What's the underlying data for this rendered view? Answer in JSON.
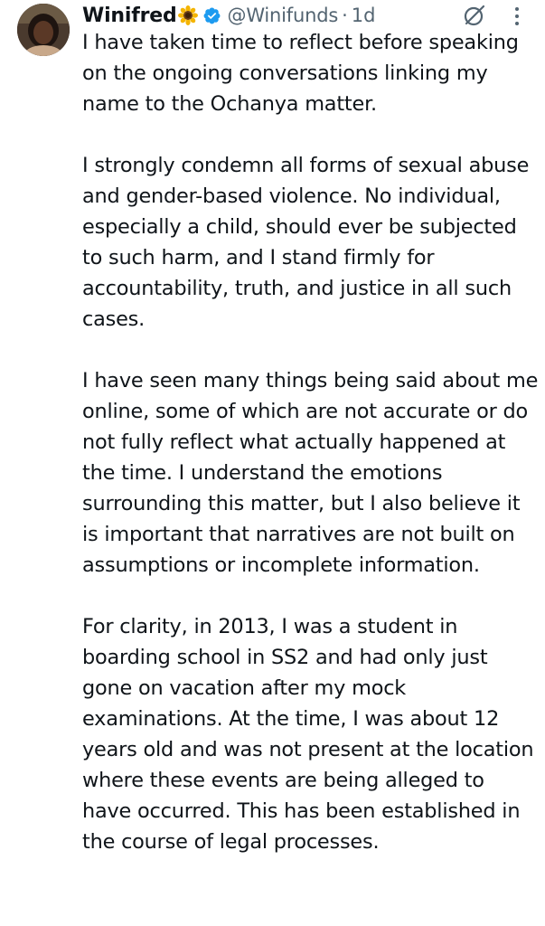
{
  "tweet": {
    "author": {
      "name": "Winifred",
      "handle": "@Winifunds",
      "separator": "·",
      "time": "1d",
      "verified": true,
      "name_emoji": "sunflower"
    },
    "icons": {
      "more": "more-vertical-icon",
      "grok": "grok-icon",
      "verified": "verified-badge-icon"
    },
    "colors": {
      "text": "#0f1419",
      "secondary": "#536471",
      "verified_blue": "#1d9bf0"
    },
    "paragraphs": [
      "I have taken time to reflect before speaking on the ongoing conversations linking my name to the Ochanya matter.",
      "I strongly condemn all forms of sexual abuse and gender-based violence. No individual, especially a child, should ever be subjected to such harm, and I stand firmly for accountability, truth, and justice in all such cases.",
      "I have seen many things being said about me online, some of which are not accurate or do not fully reflect what actually happened at the time. I understand the emotions surrounding this matter, but I also believe it is important that narratives are not built on assumptions or incomplete information.",
      "For clarity, in 2013, I was a student in boarding school in SS2 and had only just gone on vacation after my mock examinations. At the time, I was about 12 years old and was not present at the location where these events are being alleged to have occurred. This has been established in the course of legal processes."
    ]
  }
}
